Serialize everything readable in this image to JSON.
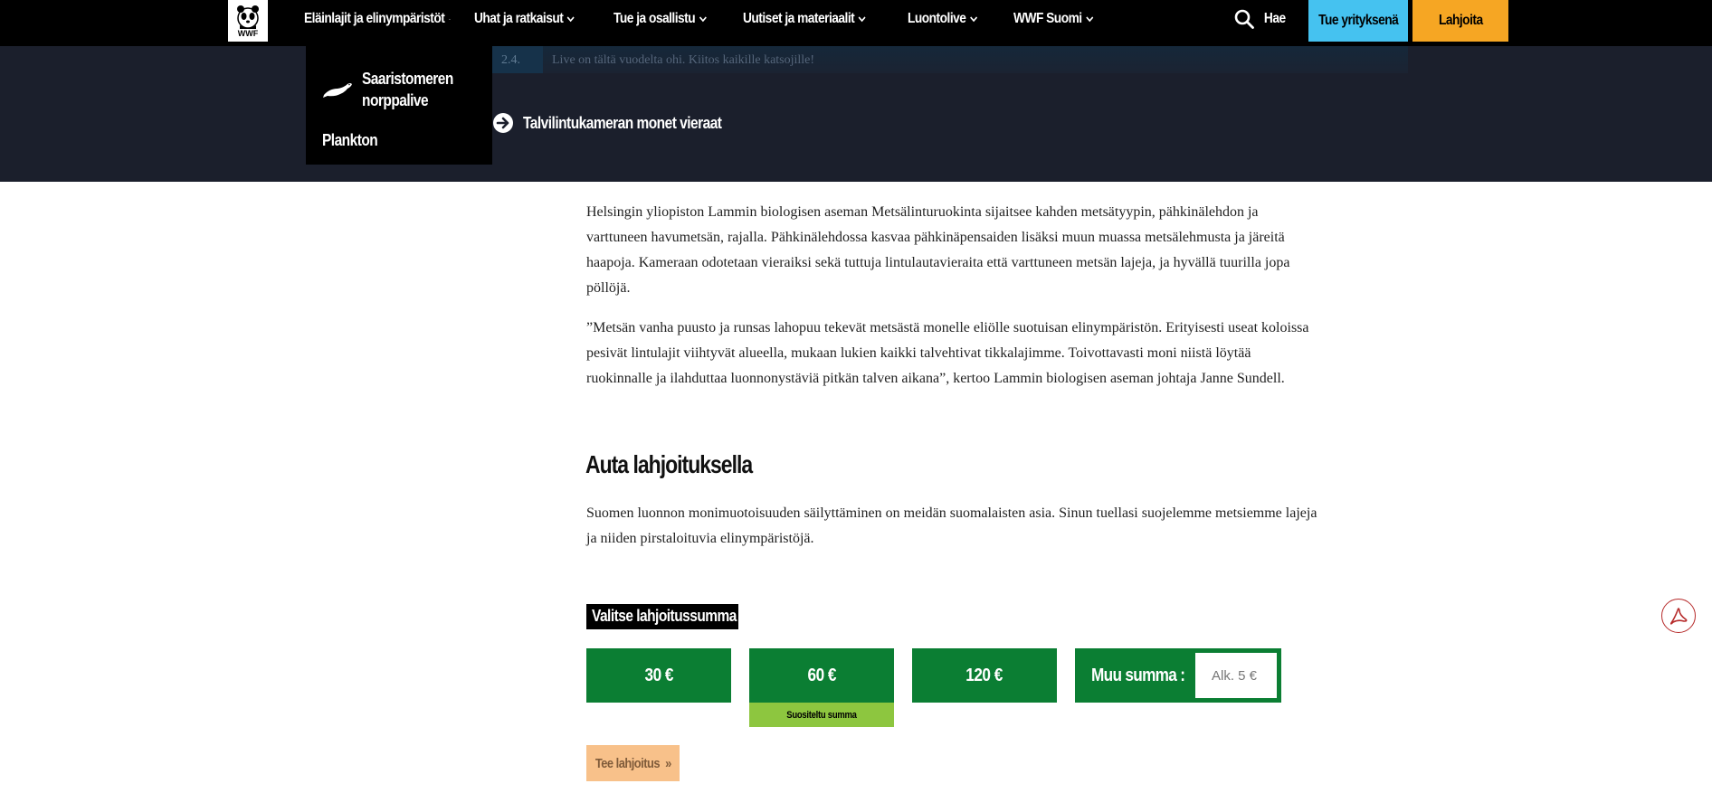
{
  "nav": {
    "logo_text": "WWF",
    "items": [
      {
        "label": "Eläinlajit ja elinympäristöt"
      },
      {
        "label": "Uhat ja ratkaisut"
      },
      {
        "label": "Tue ja osallistu"
      },
      {
        "label": "Uutiset ja materiaalit"
      },
      {
        "label": "Luontolive"
      },
      {
        "label": "WWF Suomi"
      }
    ],
    "search_label": "Hae",
    "corporate_label": "Tue yrityksenä",
    "donate_label": "Lahjoita",
    "colors": {
      "corporate": "#45c2f0",
      "donate": "#f6a623"
    }
  },
  "dropdown": {
    "items": [
      {
        "label_line1": "Saaristomeren",
        "label_line2": "norppalive",
        "icon": "seal-icon"
      },
      {
        "label": "Plankton"
      }
    ]
  },
  "hero": {
    "date": "2.4.",
    "note": "Live on tältä vuodelta ohi. Kiitos kaikille katsojille!",
    "link_label": "Talvilintukameran monet vieraat"
  },
  "article": {
    "paragraph1": "Helsingin yliopiston Lammin biologisen aseman Metsälinturuokinta sijaitsee kahden metsätyypin, pähkinälehdon ja varttuneen havumetsän, rajalla. Pähkinälehdossa kasvaa pähkinäpensaiden lisäksi muun muassa metsälehmusta ja järeitä haapoja. Kameraan odotetaan vieraiksi sekä tuttuja lintulautavieraita että varttuneen metsän lajeja, ja hyvällä tuurilla jopa pöllöjä.",
    "paragraph2": "”Metsän vanha puusto ja runsas lahopuu tekevät metsästä monelle eliölle suotuisan elinympäristön. Erityisesti useat koloissa pesivät lintulajit viihtyvät alueella, mukaan lukien kaikki talvehtivat tikkalajimme. Toivottavasti moni niistä löytää ruokinnalle ja ilahduttaa luonnonystäviä pitkän talven aikana”, kertoo Lammin biologisen aseman johtaja Janne Sundell.",
    "heading": "Auta lahjoituksella",
    "paragraph3": "Suomen luonnon monimuotoisuuden säilyttäminen on meidän suomalaisten asia. Sinun tuellasi suojelemme metsiemme lajeja ja niiden pirstaloituvia elinympäristöjä."
  },
  "donation": {
    "select_label": "Valitse lahjoitussumma",
    "amounts": [
      "30 €",
      "60 €",
      "120 €"
    ],
    "recommended_label": "Suositeltu summa",
    "other_label": "Muu summa :",
    "other_placeholder": "Alk. 5 €",
    "submit_label": "Tee lahjoitus  »",
    "colors": {
      "amount": "#0b7e33",
      "recommended": "#8dc63f",
      "submit": "#f8c18a"
    }
  }
}
